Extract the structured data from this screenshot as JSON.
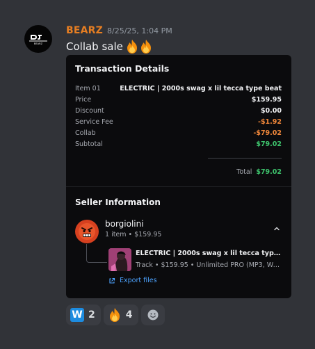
{
  "message": {
    "author": "BEARZ",
    "timestamp": "8/25/25, 1:04 PM",
    "content": "Collab sale",
    "content_emojis": [
      "fire",
      "fire"
    ],
    "avatar_text": "BEARZ",
    "colors": {
      "author": "#e67e22",
      "background": "#313338"
    }
  },
  "embed": {
    "title": "Transaction Details",
    "rows": [
      {
        "label": "Item 01",
        "value": "ELECTRIC | 2000s swag x lil tecca type beat",
        "tone": "normal"
      },
      {
        "label": "Price",
        "value": "$159.95",
        "tone": "normal"
      },
      {
        "label": "Discount",
        "value": "$0.00",
        "tone": "normal"
      },
      {
        "label": "Service Fee",
        "value": "-$1.92",
        "tone": "negative"
      },
      {
        "label": "Collab",
        "value": "-$79.02",
        "tone": "negative"
      },
      {
        "label": "Subtotal",
        "value": "$79.02",
        "tone": "positive"
      }
    ],
    "total": {
      "label": "Total",
      "value": "$79.02"
    },
    "seller_section": {
      "title": "Seller Information",
      "seller_name": "borgiolini",
      "seller_meta": "1 item • $159.95",
      "track": {
        "title": "ELECTRIC | 2000s swag x lil tecca type b...",
        "meta": "Track • $159.95 • Unlimited PRO (MP3, WA..."
      },
      "export_label": "Export files"
    },
    "colors": {
      "negative": "#f0873a",
      "positive": "#3ec46d",
      "link": "#4da3ff"
    }
  },
  "reactions": [
    {
      "emoji": "w-letter-icon",
      "count": "2"
    },
    {
      "emoji": "fire-icon",
      "count": "4"
    }
  ]
}
